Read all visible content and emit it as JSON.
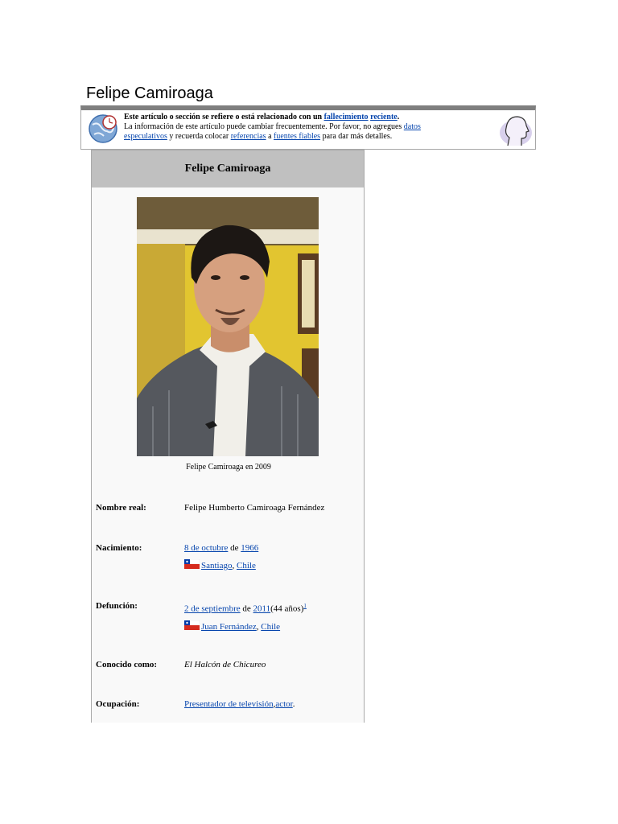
{
  "page": {
    "title": "Felipe Camiroaga"
  },
  "notice": {
    "bold_prefix": "Este artículo o sección se refiere o está relacionado con un",
    "link_fallecimiento": "fallecimiento",
    "link_reciente": "reciente",
    "period": ".",
    "line2": "La información de este artículo puede cambiar frecuentemente. Por favor, no agregues",
    "link_datos": "datos",
    "link_especulativos": "especulativos",
    "mid": "y recuerda colocar",
    "link_referencias": "referencias",
    "a": "a",
    "link_fuentes": "fuentes fiables",
    "end": "para dar más detalles."
  },
  "infobox": {
    "title": "Felipe Camiroaga",
    "caption": "Felipe Camiroaga en 2009",
    "rows": [
      {
        "label": "Nombre real:",
        "value": "Felipe Humberto Camiroaga Fernández"
      },
      {
        "label": "Nacimiento:",
        "date_day": "8 de octubre",
        "de": "de",
        "year": "1966",
        "city": "Santiago",
        "country": "Chile"
      },
      {
        "label": "Defunción:",
        "date_day": "2 de septiembre",
        "de": "de",
        "year": "2011",
        "age": "(44 años)",
        "ref": "1",
        "city": "Juan Fernández",
        "country": "Chile"
      },
      {
        "label": "Conocido como:",
        "value": "El Halcón de Chicureo"
      },
      {
        "label": "Ocupación:",
        "link1": "Presentador de televisión",
        "sep": ",",
        "link2": "actor",
        "end": "."
      }
    ]
  },
  "colors": {
    "link": "#0645ad",
    "title_bg": "#c0c0c0",
    "notice_border": "#7f7f7f"
  },
  "icons": {
    "notice_left": "globe-clock-icon",
    "notice_right": "head-silhouette-icon",
    "flag": "chile-flag-icon"
  }
}
